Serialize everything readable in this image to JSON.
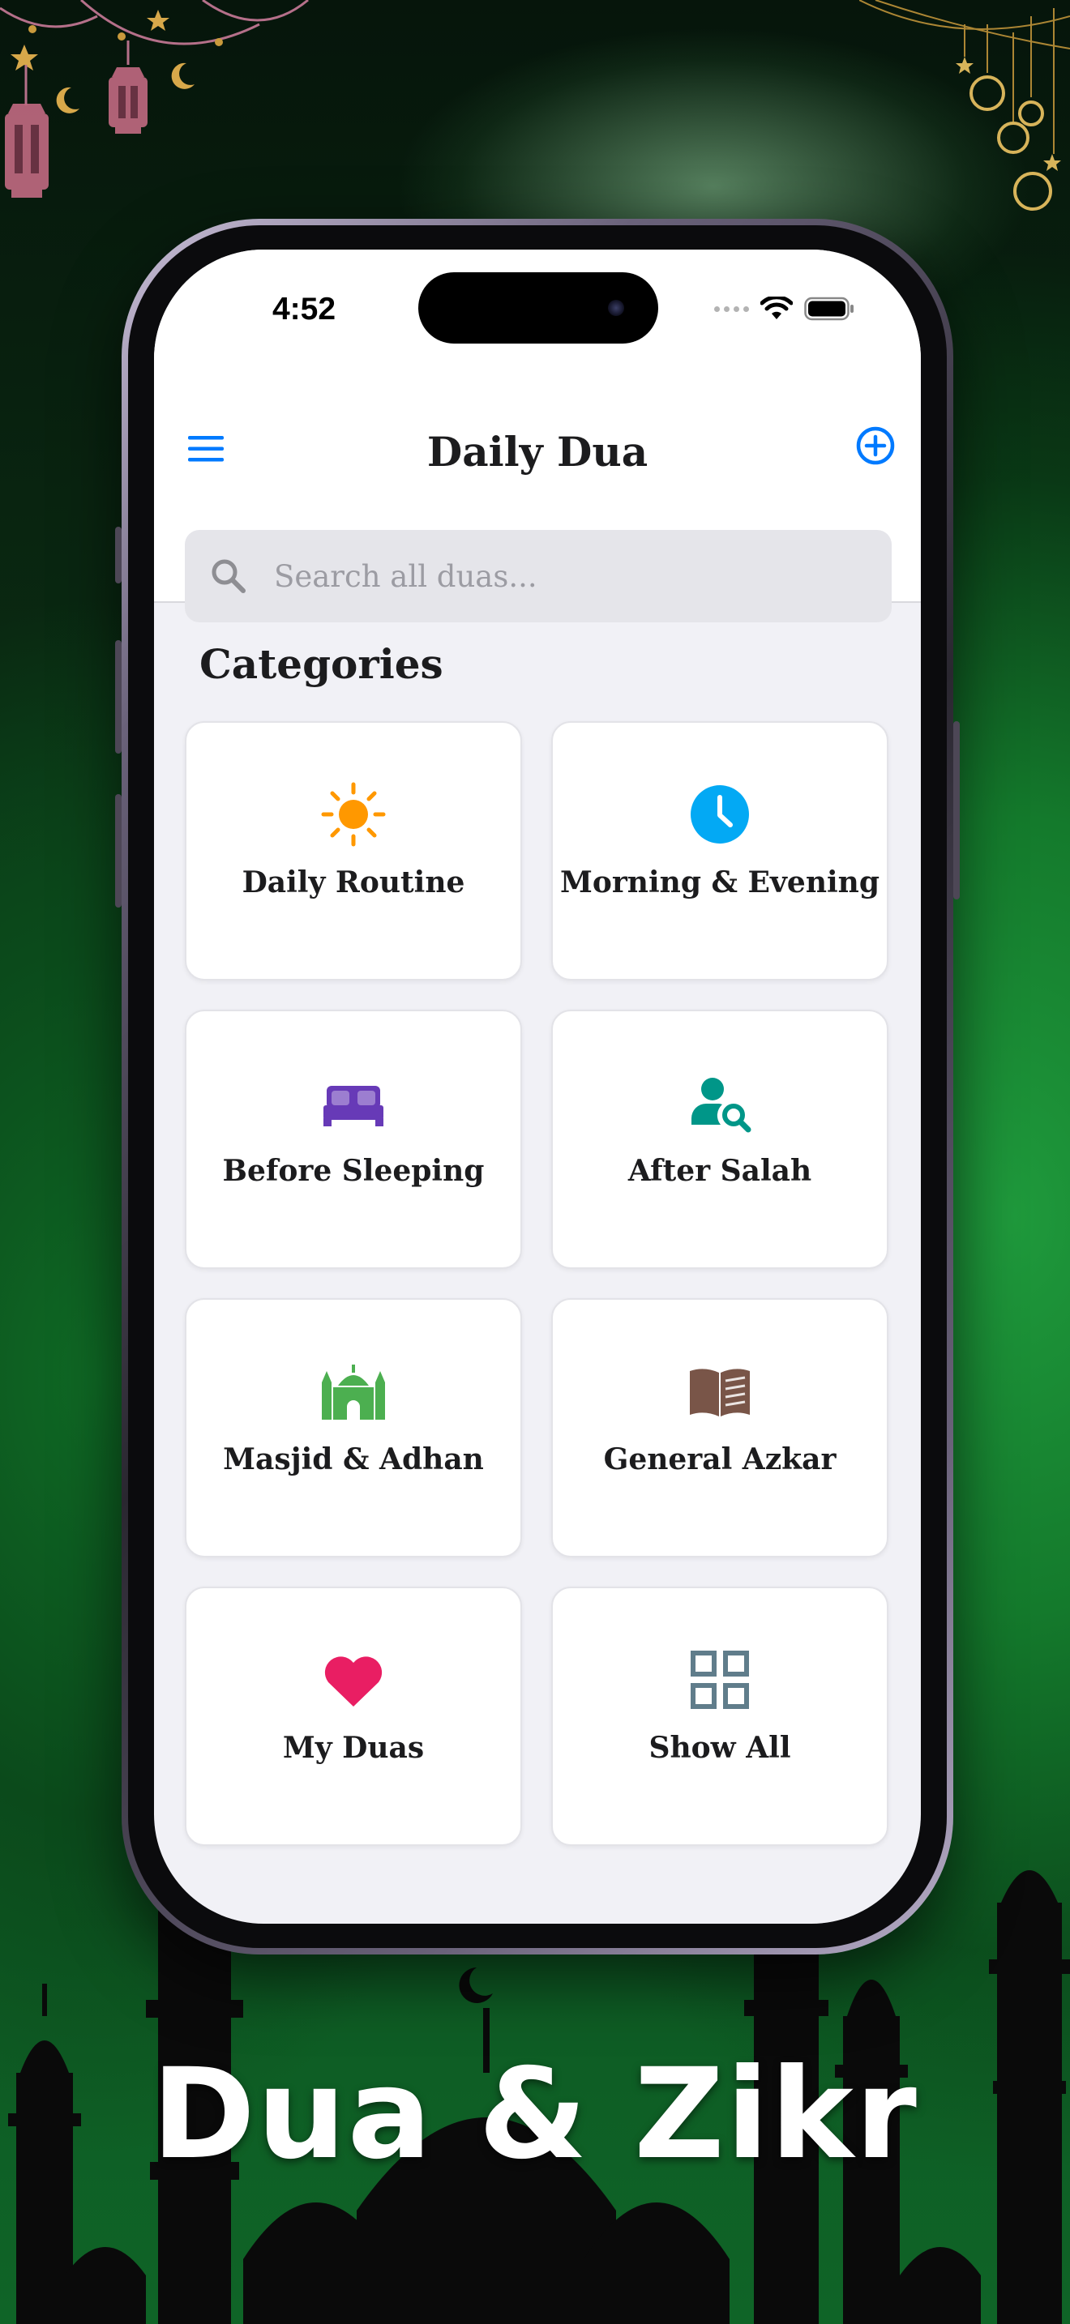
{
  "status_bar": {
    "time": "4:52"
  },
  "header": {
    "title": "Daily Dua",
    "menu_icon": "hamburger-menu-icon",
    "add_icon": "plus-circle-icon"
  },
  "search": {
    "placeholder": "Search all duas...",
    "value": ""
  },
  "categories": {
    "title": "Categories",
    "items": [
      {
        "label": "Daily Routine",
        "icon": "sun-icon",
        "color": "#FF9800"
      },
      {
        "label": "Morning & Evening",
        "icon": "clock-icon",
        "color": "#03A9F4"
      },
      {
        "label": "Before Sleeping",
        "icon": "bed-icon",
        "color": "#673AB7"
      },
      {
        "label": "After Salah",
        "icon": "person-search-icon",
        "color": "#009688"
      },
      {
        "label": "Masjid & Adhan",
        "icon": "mosque-icon",
        "color": "#4CAF50"
      },
      {
        "label": "General Azkar",
        "icon": "open-book-icon",
        "color": "#795548"
      },
      {
        "label": "My Duas",
        "icon": "heart-icon",
        "color": "#E91E63"
      },
      {
        "label": "Show All",
        "icon": "grid-icon",
        "color": "#607D8B"
      }
    ]
  },
  "caption": "Dua & Zikr",
  "colors": {
    "accent": "#007AFF",
    "background_green": "#147A2C"
  }
}
